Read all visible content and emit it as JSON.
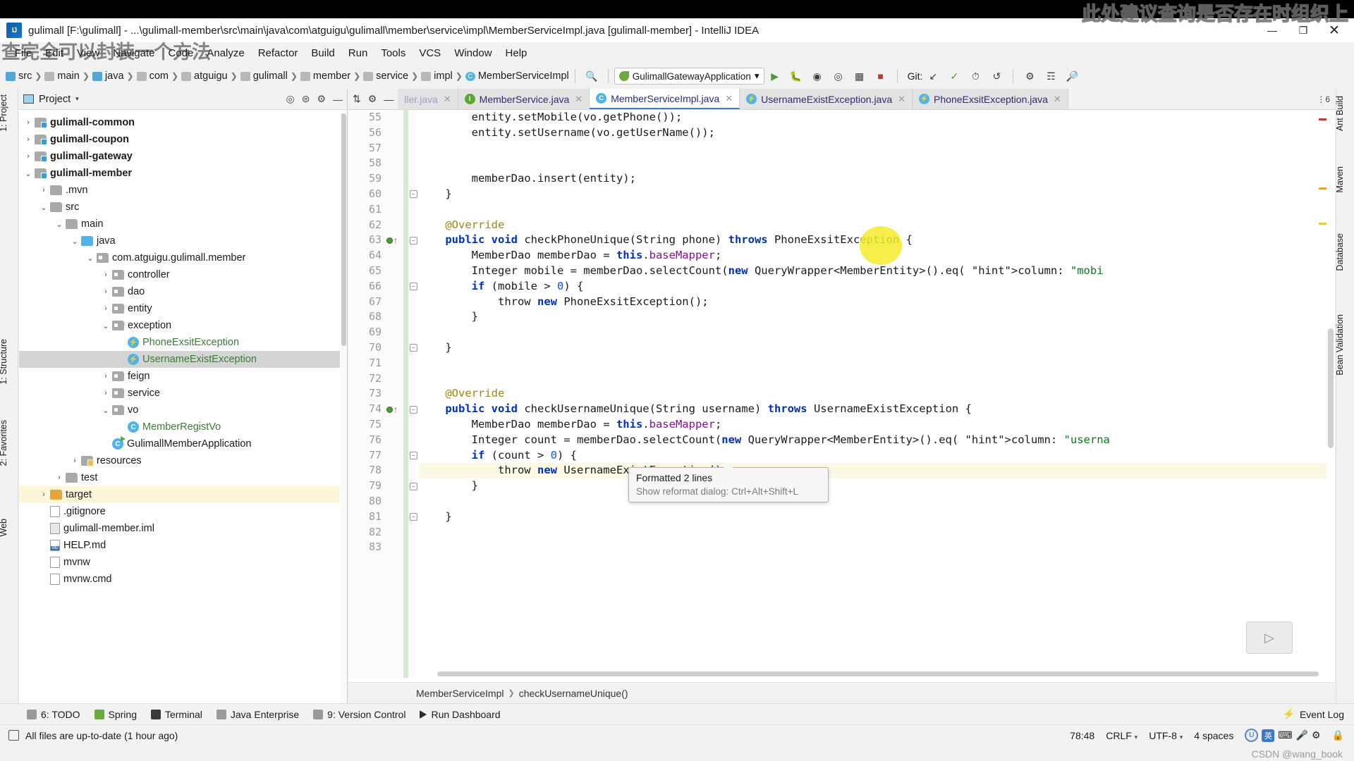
{
  "window": {
    "title": "gulimall [F:\\gulimall] - ...\\gulimall-member\\src\\main\\java\\com\\atguigu\\gulimall\\member\\service\\impl\\MemberServiceImpl.java [gulimall-member] - IntelliJ IDEA",
    "minimize": "—",
    "maximize": "❐",
    "close": "✕"
  },
  "overlay": {
    "top_right_note": "此处建议查询是否存在时组织上",
    "left_note": "查完全可以封装一个方法"
  },
  "menu": [
    "File",
    "Edit",
    "View",
    "Navigate",
    "Code",
    "Analyze",
    "Refactor",
    "Build",
    "Run",
    "Tools",
    "VCS",
    "Window",
    "Help"
  ],
  "toolbar": {
    "breadcrumbs": [
      "src",
      "main",
      "java",
      "com",
      "atguigu",
      "gulimall",
      "member",
      "service",
      "impl",
      "MemberServiceImpl"
    ],
    "run_config": "GulimallGatewayApplication",
    "git_label": "Git:",
    "search_icon": "search-icon"
  },
  "left_strip": [
    "1: Project",
    "1: Structure",
    "2: Favorites",
    "Web"
  ],
  "right_strip": [
    "Ant Build",
    "Maven",
    "Database",
    "Bean Validation"
  ],
  "project_panel": {
    "header": "Project",
    "tree": [
      {
        "depth": 1,
        "arrow": "›",
        "icon": "module-folder-icon",
        "label": "gulimall-common",
        "bold": true
      },
      {
        "depth": 1,
        "arrow": "›",
        "icon": "module-folder-icon",
        "label": "gulimall-coupon",
        "bold": true
      },
      {
        "depth": 1,
        "arrow": "›",
        "icon": "module-folder-icon",
        "label": "gulimall-gateway",
        "bold": true
      },
      {
        "depth": 1,
        "arrow": "⌄",
        "icon": "module-folder-icon",
        "label": "gulimall-member",
        "bold": true
      },
      {
        "depth": 2,
        "arrow": "›",
        "icon": "folder-icon",
        "label": ".mvn"
      },
      {
        "depth": 2,
        "arrow": "⌄",
        "icon": "folder-icon",
        "label": "src"
      },
      {
        "depth": 3,
        "arrow": "⌄",
        "icon": "folder-icon",
        "label": "main"
      },
      {
        "depth": 4,
        "arrow": "⌄",
        "icon": "source-folder-icon",
        "label": "java"
      },
      {
        "depth": 5,
        "arrow": "⌄",
        "icon": "package-icon",
        "label": "com.atguigu.gulimall.member"
      },
      {
        "depth": 6,
        "arrow": "›",
        "icon": "package-icon",
        "label": "controller"
      },
      {
        "depth": 6,
        "arrow": "›",
        "icon": "package-icon",
        "label": "dao"
      },
      {
        "depth": 6,
        "arrow": "›",
        "icon": "package-icon",
        "label": "entity"
      },
      {
        "depth": 6,
        "arrow": "⌄",
        "icon": "package-icon",
        "label": "exception"
      },
      {
        "depth": 7,
        "arrow": "",
        "icon": "exception-class-icon",
        "label": "PhoneExsitException",
        "green": true
      },
      {
        "depth": 7,
        "arrow": "",
        "icon": "exception-class-icon",
        "label": "UsernameExistException",
        "green": true,
        "selected": true
      },
      {
        "depth": 6,
        "arrow": "›",
        "icon": "package-icon",
        "label": "feign"
      },
      {
        "depth": 6,
        "arrow": "›",
        "icon": "package-icon",
        "label": "service"
      },
      {
        "depth": 6,
        "arrow": "⌄",
        "icon": "package-icon",
        "label": "vo"
      },
      {
        "depth": 7,
        "arrow": "",
        "icon": "class-icon",
        "label": "MemberRegistVo",
        "green": true
      },
      {
        "depth": 6,
        "arrow": "",
        "icon": "runnable-class-icon",
        "label": "GulimallMemberApplication"
      },
      {
        "depth": 4,
        "arrow": "›",
        "icon": "resources-folder-icon",
        "label": "resources"
      },
      {
        "depth": 3,
        "arrow": "›",
        "icon": "folder-icon",
        "label": "test"
      },
      {
        "depth": 2,
        "arrow": "›",
        "icon": "target-folder-icon",
        "label": "target",
        "highlight": true
      },
      {
        "depth": 2,
        "arrow": "",
        "icon": "file-icon",
        "label": ".gitignore"
      },
      {
        "depth": 2,
        "arrow": "",
        "icon": "iml-file-icon",
        "label": "gulimall-member.iml"
      },
      {
        "depth": 2,
        "arrow": "",
        "icon": "markdown-file-icon",
        "label": "HELP.md"
      },
      {
        "depth": 2,
        "arrow": "",
        "icon": "file-icon",
        "label": "mvnw"
      },
      {
        "depth": 2,
        "arrow": "",
        "icon": "file-icon",
        "label": "mvnw.cmd"
      }
    ]
  },
  "editor": {
    "tabs": [
      {
        "label": "ller.java",
        "icon": "class-icon",
        "state": "dim",
        "closable": true
      },
      {
        "label": "MemberService.java",
        "icon": "interface-icon",
        "state": "inactive",
        "closable": true
      },
      {
        "label": "MemberServiceImpl.java",
        "icon": "class-icon",
        "state": "active",
        "closable": true
      },
      {
        "label": "UsernameExistException.java",
        "icon": "exception-class-icon",
        "state": "inactive",
        "closable": true
      },
      {
        "label": "PhoneExsitException.java",
        "icon": "exception-class-icon",
        "state": "inactive",
        "closable": true
      }
    ],
    "tab_overflow": "⋮6",
    "first_line_number": 55,
    "lines": [
      {
        "n": 55,
        "text": "        entity.setMobile(vo.getPhone());"
      },
      {
        "n": 56,
        "text": "        entity.setUsername(vo.getUserName());"
      },
      {
        "n": 57,
        "text": ""
      },
      {
        "n": 58,
        "text": ""
      },
      {
        "n": 59,
        "text": "        memberDao.insert(entity);"
      },
      {
        "n": 60,
        "text": "    }",
        "fold": true
      },
      {
        "n": 61,
        "text": ""
      },
      {
        "n": 62,
        "text": "    @Override"
      },
      {
        "n": 63,
        "text": "    public void checkPhoneUnique(String phone) throws PhoneExsitException {",
        "fold": true,
        "override": true
      },
      {
        "n": 64,
        "text": "        MemberDao memberDao = this.baseMapper;"
      },
      {
        "n": 65,
        "text": "        Integer mobile = memberDao.selectCount(new QueryWrapper<MemberEntity>().eq( column: \"mobi"
      },
      {
        "n": 66,
        "text": "        if (mobile > 0) {",
        "fold": true
      },
      {
        "n": 67,
        "text": "            throw new PhoneExsitException();"
      },
      {
        "n": 68,
        "text": "        }"
      },
      {
        "n": 69,
        "text": ""
      },
      {
        "n": 70,
        "text": "    }",
        "fold": true
      },
      {
        "n": 71,
        "text": ""
      },
      {
        "n": 72,
        "text": ""
      },
      {
        "n": 73,
        "text": "    @Override"
      },
      {
        "n": 74,
        "text": "    public void checkUsernameUnique(String username) throws UsernameExistException {",
        "fold": true,
        "override": true
      },
      {
        "n": 75,
        "text": "        MemberDao memberDao = this.baseMapper;"
      },
      {
        "n": 76,
        "text": "        Integer count = memberDao.selectCount(new QueryWrapper<MemberEntity>().eq( column: \"userna"
      },
      {
        "n": 77,
        "text": "        if (count > 0) {",
        "fold": true
      },
      {
        "n": 78,
        "text": "            throw new UsernameExistException();",
        "highlight": true
      },
      {
        "n": 79,
        "text": "        }",
        "fold": true
      },
      {
        "n": 80,
        "text": ""
      },
      {
        "n": 81,
        "text": "    }",
        "fold": true
      },
      {
        "n": 82,
        "text": ""
      },
      {
        "n": 83,
        "text": ""
      }
    ],
    "breadcrumb": [
      "MemberServiceImpl",
      "checkUsernameUnique()"
    ]
  },
  "tooltip": {
    "title": "Formatted 2 lines",
    "subtitle": "Show reformat dialog: Ctrl+Alt+Shift+L"
  },
  "bottom_bar": {
    "items": [
      {
        "label": "6: TODO",
        "icon": "todo-icon"
      },
      {
        "label": "Spring",
        "icon": "spring-icon"
      },
      {
        "label": "Terminal",
        "icon": "terminal-icon"
      },
      {
        "label": "Java Enterprise",
        "icon": "java-enterprise-icon"
      },
      {
        "label": "9: Version Control",
        "icon": "version-control-icon"
      },
      {
        "label": "Run Dashboard",
        "icon": "run-dashboard-icon"
      }
    ],
    "event_log": "Event Log"
  },
  "status_bar": {
    "message": "All files are up-to-date (1 hour ago)",
    "caret": "78:48",
    "line_separator": "CRLF",
    "encoding": "UTF-8",
    "indent": "4 spaces",
    "ime_lang": "英"
  },
  "watermark": "CSDN @wang_book",
  "colors": {
    "accent": "#3c7fd0",
    "keyword": "#0033b3",
    "string": "#067d17",
    "field": "#871094",
    "annotation": "#9e880d",
    "number": "#1750eb",
    "selection": "#d4d4d4",
    "cursor_highlight": "#f5ec2c"
  }
}
